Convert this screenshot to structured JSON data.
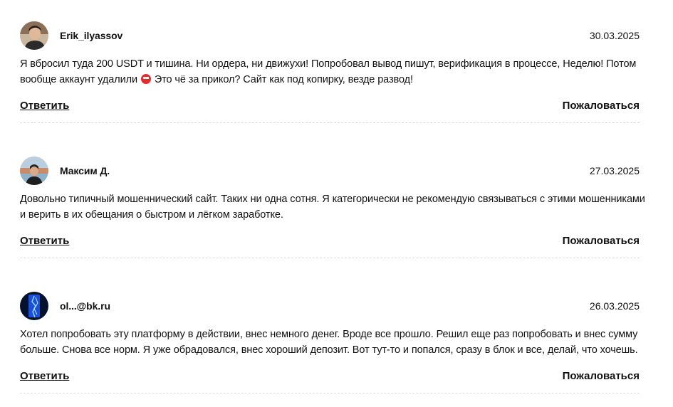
{
  "comments": [
    {
      "author": "Erik_ilyassov",
      "date": "30.03.2025",
      "text_before_emoji": "Я вбросил туда 200 USDT и тишина. Ни ордера, ни движухи! Попробовал вывод пишут, верификация в процессе, Неделю! Потом вообще аккаунт удалили",
      "emoji_icon": "angry-face-emoji",
      "text_after_emoji": "Это чё за прикол? Сайт как под копирку, везде развод!",
      "reply_label": "Ответить",
      "report_label": "Пожаловаться"
    },
    {
      "author": "Максим Д.",
      "date": "27.03.2025",
      "text": "Довольно типичный мошеннический сайт. Таких ни одна сотня. Я категорически не рекомендую связываться с этими мошенниками и верить в их обещания о быстром и лёгком заработке.",
      "reply_label": "Ответить",
      "report_label": "Пожаловаться"
    },
    {
      "author": "ol...@bk.ru",
      "date": "26.03.2025",
      "text": "Хотел попробовать эту платформу в действии, внес немного денег. Вроде все прошло. Решил еще раз попробовать и внес сумму больше. Снова все норм. Я уже обрадовался, внес хороший депозит. Вот тут-то и попался, сразу в блок и все, делай, что хочешь.",
      "reply_label": "Ответить",
      "report_label": "Пожаловаться"
    }
  ],
  "colors": {
    "text": "#111111",
    "divider": "#dcdcdc",
    "emoji": "#e52d2d"
  }
}
